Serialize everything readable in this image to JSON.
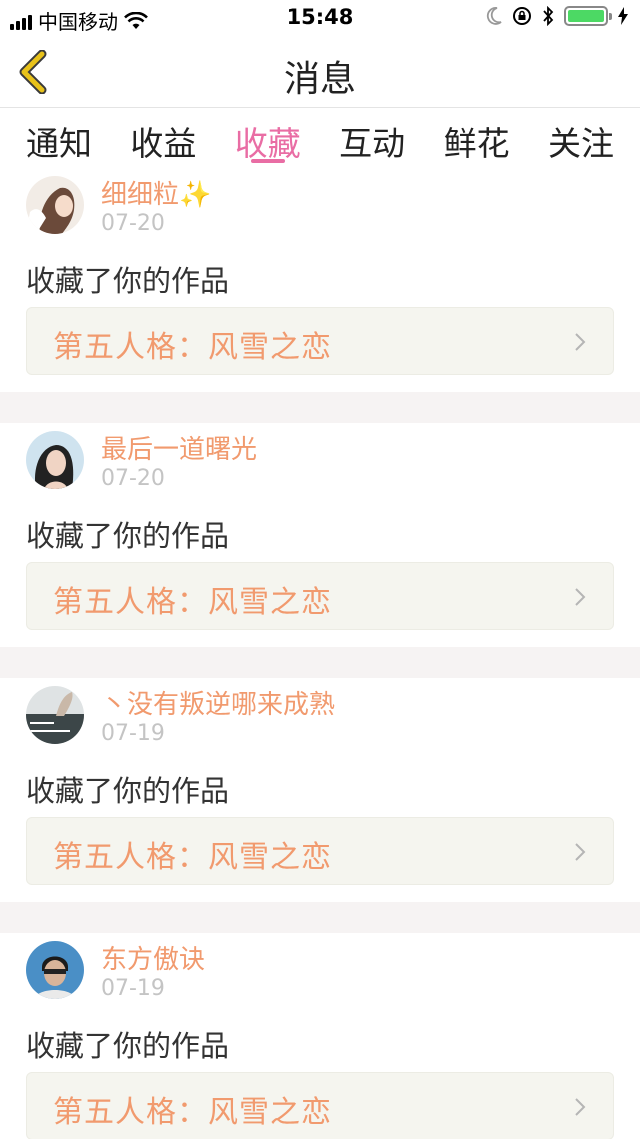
{
  "status_bar": {
    "carrier": "中国移动",
    "time": "15:48"
  },
  "nav": {
    "title": "消息"
  },
  "tabs": [
    {
      "label": "通知"
    },
    {
      "label": "收益"
    },
    {
      "label": "收藏",
      "active": true
    },
    {
      "label": "互动"
    },
    {
      "label": "鲜花"
    },
    {
      "label": "关注"
    }
  ],
  "items": [
    {
      "username": "细细粒✨",
      "date": "07-20",
      "action": "收藏了你的作品",
      "work_title": "第五人格：风雪之恋"
    },
    {
      "username": "最后一道曙光",
      "date": "07-20",
      "action": "收藏了你的作品",
      "work_title": "第五人格：风雪之恋"
    },
    {
      "username": "丶没有叛逆哪来成熟",
      "date": "07-19",
      "action": "收藏了你的作品",
      "work_title": "第五人格：风雪之恋"
    },
    {
      "username": "东方傲诀",
      "date": "07-19",
      "action": "收藏了你的作品",
      "work_title": "第五人格：风雪之恋"
    }
  ],
  "colors": {
    "accent_pink": "#e96da4",
    "name_orange": "#f19a6e",
    "back_yellow": "#e8c21a",
    "card_bg": "#f5f5ef"
  }
}
